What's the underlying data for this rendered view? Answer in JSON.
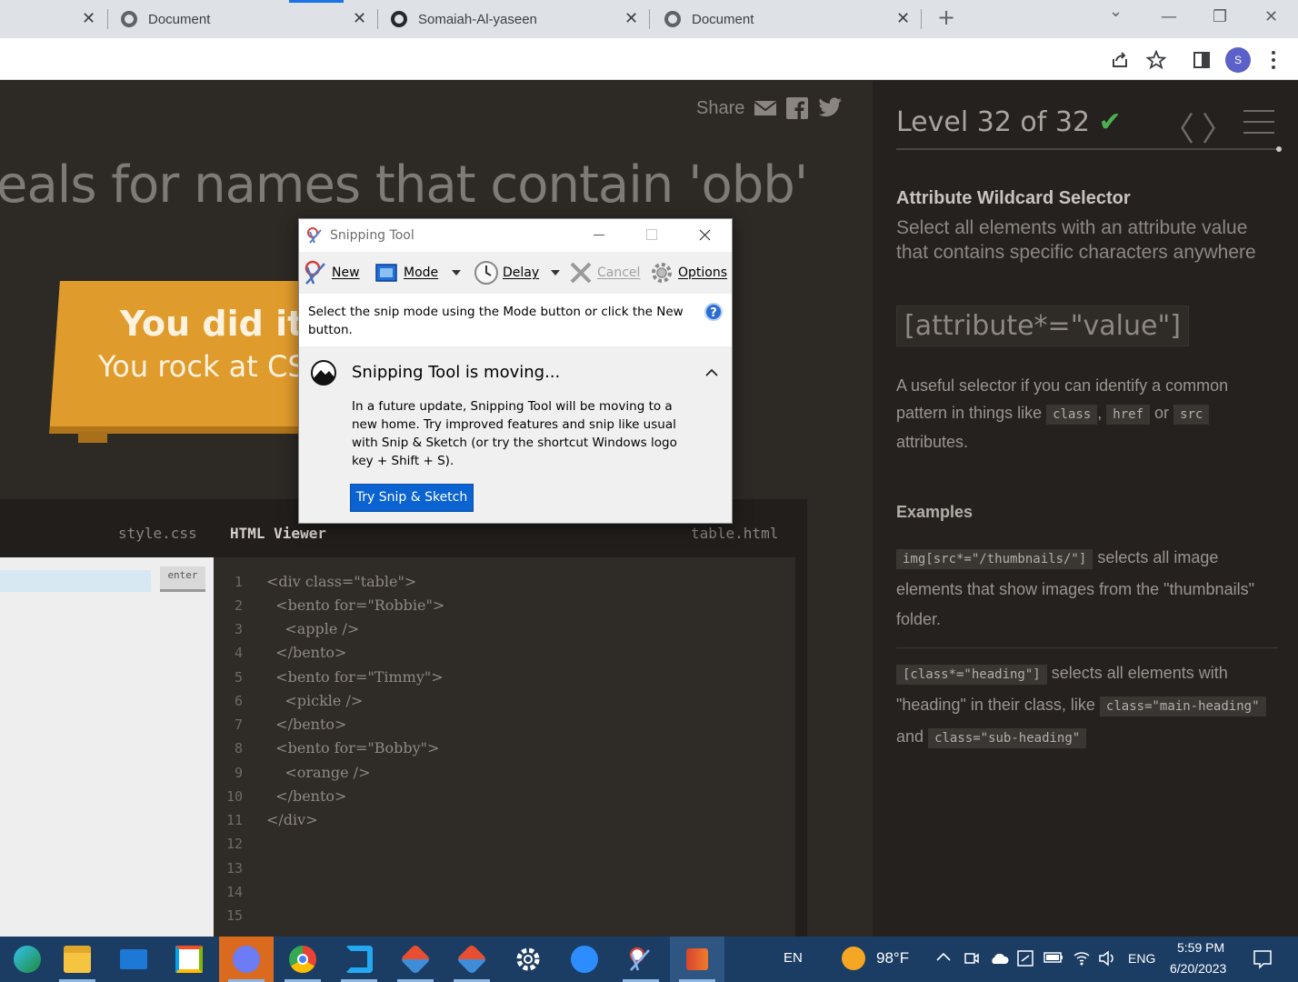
{
  "browser": {
    "tabs": [
      {
        "label": "Document",
        "close": "✕"
      },
      {
        "label": "Somaiah-Al-yaseen",
        "close": "✕"
      },
      {
        "label": "Document",
        "close": "✕"
      }
    ],
    "first_tab_close": "✕",
    "new_tab": "+",
    "window_controls": {
      "dropdown": "⌄",
      "minimize": "—",
      "restore": "❐",
      "close": "✕"
    },
    "toolbar_icons": [
      "share-icon",
      "star-icon",
      "sidebar-icon",
      "menu-dots-icon"
    ],
    "avatar_letter": "S"
  },
  "game": {
    "share_label": "Share",
    "headline": "eals for names that contain 'obb'",
    "banner_line1": "You did it",
    "banner_line2": "You rock at CS",
    "editor": {
      "tab_css": "style.css",
      "tab_html": "HTML Viewer",
      "tab_file": "table.html",
      "enter_label": "enter",
      "line_numbers": [
        "1",
        "2",
        "3",
        "4",
        "5",
        "6",
        "7",
        "8",
        "9",
        "10",
        "11",
        "12",
        "13",
        "14",
        "15"
      ],
      "code_lines": [
        "<div class=\"table\">",
        "  <bento for=\"Robbie\">",
        "    <apple />",
        "  </bento>",
        "  <bento for=\"Timmy\">",
        "    <pickle />",
        "  </bento>",
        "  <bento for=\"Bobby\">",
        "    <orange />",
        "  </bento>",
        "</div>"
      ]
    },
    "sidebar": {
      "level": "Level 32 of 32",
      "level_check": "✔",
      "prev": "〈",
      "next": "〉",
      "selector_name": "Attribute Wildcard Selector",
      "selector_desc": "Select all elements with an attribute value that contains specific characters anywhere",
      "syntax": "[attribute*=\"value\"]",
      "hint_pre": "A useful selector if you can identify a common pattern in things like",
      "hint_code1": "class",
      "hint_comma": ",",
      "hint_code2": "href",
      "hint_or": "or",
      "hint_code3": "src",
      "hint_post": "attributes.",
      "examples_title": "Examples",
      "ex1_code": "img[src*=\"/thumbnails/\"]",
      "ex1_text": "selects all image elements that show images from the \"thumbnails\" folder.",
      "ex2_code": "[class*=\"heading\"]",
      "ex2_text": "selects all elements with \"heading\" in their class, like",
      "ex2_code2": "class=\"main-heading\"",
      "ex2_and": "and",
      "ex2_code3": "class=\"sub-heading\""
    }
  },
  "snipping_tool": {
    "title": "Snipping Tool",
    "new_label": "New",
    "mode_label": "Mode",
    "delay_label": "Delay",
    "cancel_label": "Cancel",
    "options_label": "Options",
    "message": "Select the snip mode using the Mode button or click the New button.",
    "notice_title": "Snipping Tool is moving...",
    "notice_body": "In a future update, Snipping Tool will be moving to a new home. Try improved features and snip like usual with Snip & Sketch (or try the shortcut Windows logo key + Shift + S).",
    "try_button": "Try Snip & Sketch",
    "help": "?"
  },
  "taskbar": {
    "apps": [
      "edge-icon",
      "file-explorer-icon",
      "mail-icon",
      "store-icon",
      "discord-icon",
      "chrome-icon",
      "vscode-icon",
      "git-icon",
      "git-icon",
      "settings-icon",
      "zoom-icon",
      "snipping-tool-icon",
      "app-icon"
    ],
    "lang_short": "EN",
    "weather": "98°F",
    "lang": "ENG",
    "time": "5:59 PM",
    "date": "6/20/2023"
  },
  "colors": {
    "page_bg": "#2d2925",
    "sidebar_bg": "#25211e",
    "banner": "#e09b2d",
    "accent_check": "#4cb050",
    "try_button": "#0a63d1",
    "taskbar": "#1b3d64"
  }
}
